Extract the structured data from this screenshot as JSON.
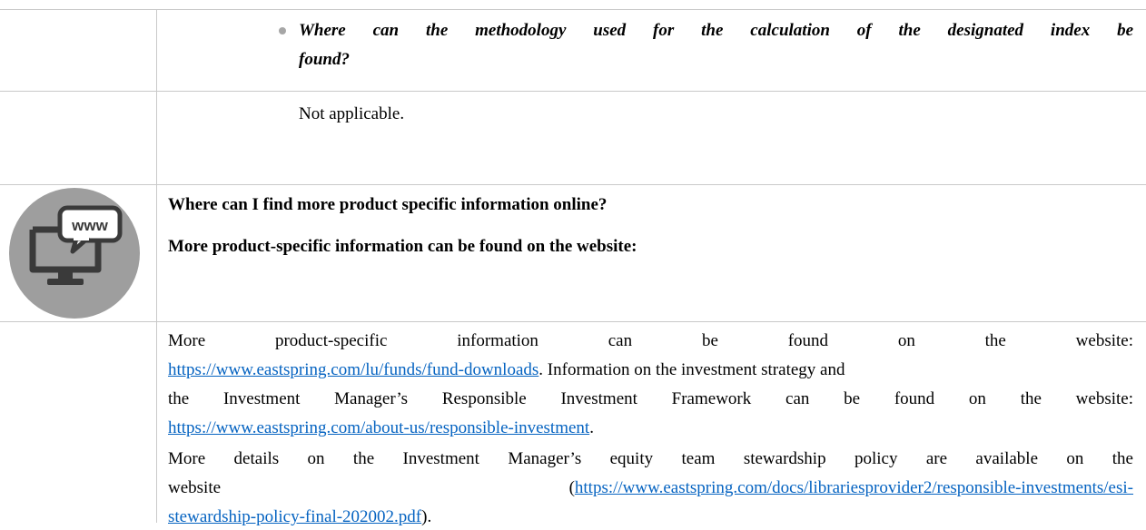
{
  "section_question": {
    "line1": "Where can the methodology used for the calculation of the designated index be",
    "line2": "found?"
  },
  "section_answer": "Not applicable.",
  "online_info": {
    "heading": "Where can I find more product specific information online?",
    "subheading": "More product-specific information can be found on the website:",
    "icon": "www-monitor-icon",
    "icon_label": "www"
  },
  "paragraph1": {
    "words_line1": [
      "More",
      "product-specific",
      "information",
      "can",
      "be",
      "found",
      "on",
      "the",
      "website:"
    ],
    "link1": "https://www.eastspring.com/lu/funds/fund-downloads",
    "line2_text": ". Information on the investment strategy and",
    "line3_text": "the Investment Manager’s Responsible Investment Framework can be found on the website:",
    "link2": "https://www.eastspring.com/about-us/responsible-investment",
    "link2_tail": "."
  },
  "paragraph2": {
    "line1": "More details on the Investment Manager’s equity team stewardship policy are available on the",
    "line2_word": "website",
    "line2_link_open": "(",
    "link3_part1": "https://www.eastspring.com/docs/librariesprovider2/responsible-investments/esi-",
    "link3_part2": "stewardship-policy-final-202002.pdf",
    "link3_tail": ")."
  },
  "colors": {
    "link": "#0563c1",
    "rule": "#c9c9c9",
    "icon_circle": "#9e9e9e",
    "icon_dark": "#3a3a3a"
  }
}
